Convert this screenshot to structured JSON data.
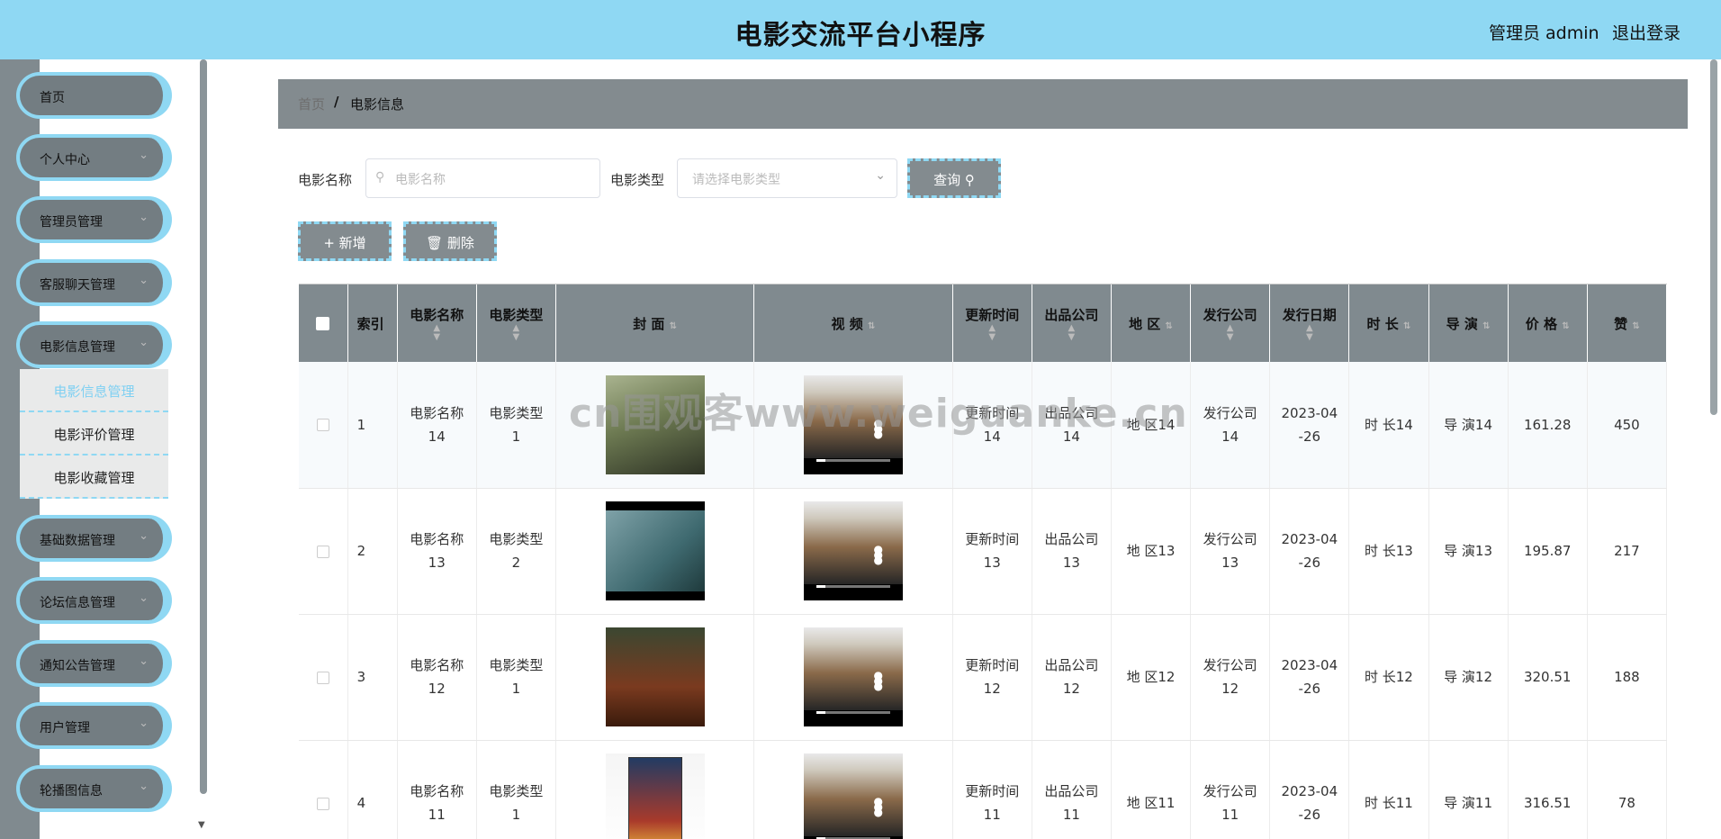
{
  "header": {
    "title": "电影交流平台小程序",
    "user": "管理员 admin",
    "logout": "退出登录"
  },
  "sidebar": {
    "items": [
      {
        "label": "首页",
        "chev": ""
      },
      {
        "label": "个人中心",
        "chev": "⌄"
      },
      {
        "label": "管理员管理",
        "chev": "⌄"
      },
      {
        "label": "客服聊天管理",
        "chev": "⌄"
      },
      {
        "label": "电影信息管理",
        "chev": "⌄"
      },
      {
        "label": "基础数据管理",
        "chev": "⌄"
      },
      {
        "label": "论坛信息管理",
        "chev": "⌄"
      },
      {
        "label": "通知公告管理",
        "chev": "⌄"
      },
      {
        "label": "用户管理",
        "chev": "⌄"
      },
      {
        "label": "轮播图信息",
        "chev": "⌄"
      }
    ],
    "submenu": [
      {
        "label": "电影信息管理"
      },
      {
        "label": "电影评价管理"
      },
      {
        "label": "电影收藏管理"
      }
    ]
  },
  "breadcrumb": {
    "home": "首页",
    "sep": "/",
    "current": "电影信息"
  },
  "search": {
    "name_label": "电影名称",
    "name_placeholder": "电影名称",
    "type_label": "电影类型",
    "type_placeholder": "请选择电影类型",
    "query_button": "查询 ⚲"
  },
  "actions": {
    "add_button": "+ 新增",
    "delete_button": "🗑 删除"
  },
  "table": {
    "columns": [
      "索引",
      "电影名称",
      "电影类型",
      "封 面",
      "视 频",
      "更新时间",
      "出品公司",
      "地 区",
      "发行公司",
      "发行日期",
      "时 长",
      "导 演",
      "价 格",
      "赞"
    ],
    "rows": [
      {
        "index": "1",
        "name": [
          "电影名称",
          "14"
        ],
        "type": [
          "电影类型",
          "1"
        ],
        "update": [
          "更新时间",
          "14"
        ],
        "company": [
          "出品公司",
          "14"
        ],
        "area": "地 区14",
        "publisher": [
          "发行公司",
          "14"
        ],
        "date": [
          "2023-04",
          "-26"
        ],
        "duration": "时 长14",
        "director": "导 演14",
        "price": "161.28",
        "likes": "450"
      },
      {
        "index": "2",
        "name": [
          "电影名称",
          "13"
        ],
        "type": [
          "电影类型",
          "2"
        ],
        "update": [
          "更新时间",
          "13"
        ],
        "company": [
          "出品公司",
          "13"
        ],
        "area": "地 区13",
        "publisher": [
          "发行公司",
          "13"
        ],
        "date": [
          "2023-04",
          "-26"
        ],
        "duration": "时 长13",
        "director": "导 演13",
        "price": "195.87",
        "likes": "217"
      },
      {
        "index": "3",
        "name": [
          "电影名称",
          "12"
        ],
        "type": [
          "电影类型",
          "1"
        ],
        "update": [
          "更新时间",
          "12"
        ],
        "company": [
          "出品公司",
          "12"
        ],
        "area": "地 区12",
        "publisher": [
          "发行公司",
          "12"
        ],
        "date": [
          "2023-04",
          "-26"
        ],
        "duration": "时 长12",
        "director": "导 演12",
        "price": "320.51",
        "likes": "188"
      },
      {
        "index": "4",
        "name": [
          "电影名称",
          "11"
        ],
        "type": [
          "电影类型",
          "1"
        ],
        "update": [
          "更新时间",
          "11"
        ],
        "company": [
          "出品公司",
          "11"
        ],
        "area": "地 区11",
        "publisher": [
          "发行公司",
          "11"
        ],
        "date": [
          "2023-04",
          "-26"
        ],
        "duration": "时 长11",
        "director": "导 演11",
        "price": "316.51",
        "likes": "78"
      }
    ]
  },
  "watermark": "cn围观客www.weiguanke.cn",
  "colors": {
    "header": "#8fd8f3",
    "accent": "#8fd8f3",
    "gray": "#838b8f"
  }
}
